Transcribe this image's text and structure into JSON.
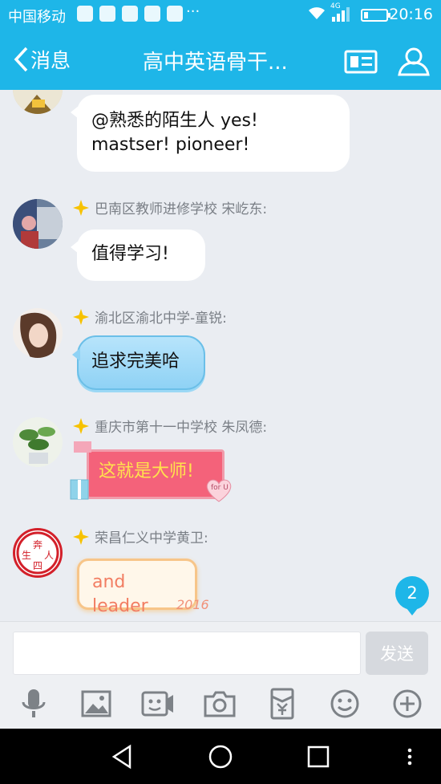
{
  "status_bar": {
    "carrier": "中国移动",
    "network": "4G",
    "time": "20:16"
  },
  "title_bar": {
    "back_label": "消息",
    "title": "高中英语骨干...",
    "card_icon": "profile-card-icon",
    "members_icon": "person-icon"
  },
  "messages": [
    {
      "sender": "",
      "text_line1": "@熟悉的陌生人  yes!",
      "text_line2": "mastser! pioneer!"
    },
    {
      "sender": "巴南区教师进修学校 宋屹东:",
      "text": "值得学习!"
    },
    {
      "sender": "渝北区渝北中学-童锐:",
      "text": "追求完美哈"
    },
    {
      "sender": "重庆市第十一中学校 朱凤德:",
      "text": "这就是大师!",
      "deco_text": "for U"
    },
    {
      "sender": "荣昌仁义中学黄卫:",
      "text": "and leader",
      "deco_text": "2016",
      "seal_chars": [
        "奔",
        "生",
        "人",
        "四"
      ]
    }
  ],
  "unread_count": "2",
  "input": {
    "placeholder": "",
    "send_label": "发送"
  },
  "tools": [
    "microphone-icon",
    "image-icon",
    "video-icon",
    "camera-icon",
    "red-packet-icon",
    "emoji-icon",
    "plus-icon"
  ],
  "colors": {
    "accent": "#1eb6e8",
    "background": "#eaedf2"
  }
}
